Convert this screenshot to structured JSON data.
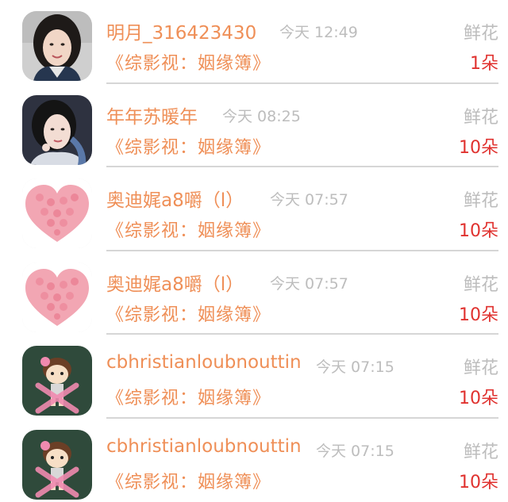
{
  "records": [
    {
      "name": "明月_316423430",
      "time": "今天 12:49",
      "gift_label": "鲜花",
      "work": "《综影视：姻缘簿》",
      "count": "1朵",
      "avatar": "photo-woman-icon"
    },
    {
      "name": "年年苏暖年",
      "time": "今天 08:25",
      "gift_label": "鲜花",
      "work": "《综影视：姻缘簿》",
      "count": "10朵",
      "avatar": "photo-woman-costume-icon"
    },
    {
      "name": "奥迪娓a8嚼（l）",
      "time": "今天 07:57",
      "gift_label": "鲜花",
      "work": "《综影视：姻缘簿》",
      "count": "10朵",
      "avatar": "rose-heart-icon"
    },
    {
      "name": "奥迪娓a8嚼（l）",
      "time": "今天 07:57",
      "gift_label": "鲜花",
      "work": "《综影视：姻缘簿》",
      "count": "10朵",
      "avatar": "rose-heart-icon"
    },
    {
      "name": "cbhristianloubnouttin",
      "time": "今天 07:15",
      "gift_label": "鲜花",
      "work": "《综影视：姻缘簿》",
      "count": "10朵",
      "avatar": "cartoon-girl-x-icon"
    },
    {
      "name": "cbhristianloubnouttin",
      "time": "今天 07:15",
      "gift_label": "鲜花",
      "work": "《综影视：姻缘簿》",
      "count": "10朵",
      "avatar": "cartoon-girl-x-icon"
    }
  ],
  "colors": {
    "accent_orange": "#ef8f57",
    "count_red": "#e0322f",
    "muted_gray": "#bdbdbd",
    "divider": "#d6d6d6"
  }
}
